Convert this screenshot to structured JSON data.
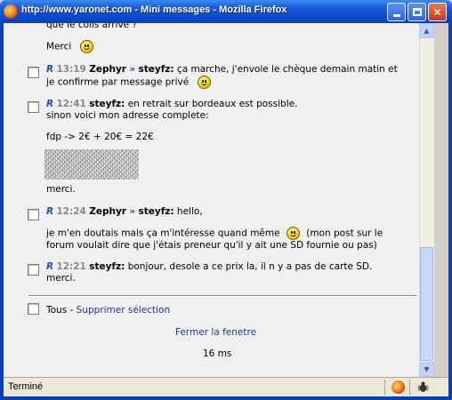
{
  "window": {
    "title": "http://www.yaronet.com - Mini messages - Mozilla Firefox"
  },
  "messages": [
    {
      "partial_lines": [
        "que le colis arrive ?",
        "Merci"
      ]
    },
    {
      "marker": "R",
      "time": "13:19",
      "from": "Zephyr",
      "arrow": "»",
      "to": "steyfz:",
      "text_line1": "ça marche, j'envoie le chèque demain matin et",
      "text_line2": "je confirme par message privé"
    },
    {
      "marker": "R",
      "time": "12:41",
      "from": "steyfz:",
      "text_line1": "en retrait sur bordeaux est possible.",
      "text_line2": "sinon voici mon adresse complete:",
      "text_line3": "fdp -> 2€ + 20€ = 22€",
      "text_line4": "merci."
    },
    {
      "marker": "R",
      "time": "12:24",
      "from": "Zephyr",
      "arrow": "»",
      "to": "steyfz:",
      "text_line1": "hello,",
      "text_line2a": "je m'en doutais mais ça m'intéresse quand même",
      "text_line2b": "(mon post sur le",
      "text_line3": "forum voulait dire que j'étais preneur qu'il y ait une SD fournie ou pas)"
    },
    {
      "marker": "R",
      "time": "12:21",
      "from": "steyfz:",
      "text_line1": "bonjour, desole a ce prix la, il n y a pas de carte SD.",
      "text_line2": "merci."
    }
  ],
  "footer": {
    "all_label": "Tous",
    "dash": "-",
    "delete_label": "Supprimer sélection",
    "close_label": "Fermer la fenetre",
    "timing": "16 ms"
  },
  "statusbar": {
    "text": "Terminé"
  }
}
